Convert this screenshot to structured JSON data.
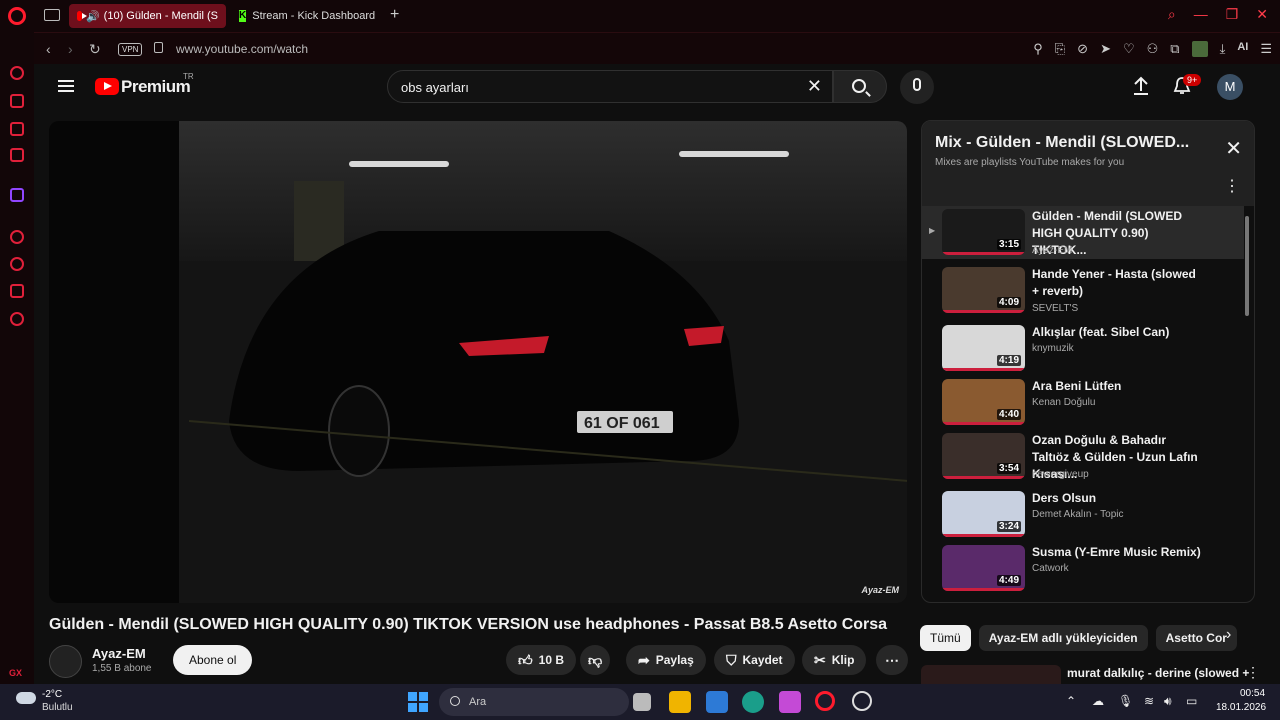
{
  "browser": {
    "tabs": [
      {
        "label": "(10) Gülden - Mendil (S"
      },
      {
        "label": "Stream - Kick Dashboard"
      }
    ],
    "url": "www.youtube.com/watch",
    "vpn_label": "VPN",
    "ai_label": "AI"
  },
  "youtube": {
    "brand": "Premium",
    "region": "TR",
    "search_query": "obs ayarları",
    "notification_count": "9+",
    "avatar_letter": "M",
    "video": {
      "title": "Gülden - Mendil (SLOWED HIGH QUALITY 0.90) TIKTOK VERSION use headphones - Passat B8.5 Asetto Corsa",
      "watermark": "Ayaz-EM",
      "channel": "Ayaz-EM",
      "subscribers": "1,55 B abone",
      "subscribe_label": "Abone ol",
      "like_count": "10 B",
      "share_label": "Paylaş",
      "save_label": "Kaydet",
      "clip_label": "Klip"
    },
    "playlist": {
      "title": "Mix - Gülden - Mendil (SLOWED...",
      "subtitle": "Mixes are playlists YouTube makes for you",
      "items": [
        {
          "title": "Gülden - Mendil (SLOWED HIGH QUALITY 0.90) TIKTOK...",
          "channel": "Ayaz-EM",
          "duration": "3:15",
          "thumb": "#1a1a1a"
        },
        {
          "title": "Hande Yener - Hasta (slowed + reverb)",
          "channel": "SEVELT'S",
          "duration": "4:09",
          "thumb": "#4a3a2e"
        },
        {
          "title": "Alkışlar (feat. Sibel Can)",
          "channel": "knymuzik",
          "duration": "4:19",
          "thumb": "#d8d8d8"
        },
        {
          "title": "Ara Beni Lütfen",
          "channel": "Kenan Doğulu",
          "duration": "4:40",
          "thumb": "#8a5a30"
        },
        {
          "title": "Ozan Doğulu & Bahadır Taltıöz & Gülden - Uzun Lafın Kısası...",
          "channel": "newergiveup",
          "duration": "3:54",
          "thumb": "#3a2e2a"
        },
        {
          "title": "Ders Olsun",
          "channel": "Demet Akalın - Topic",
          "duration": "3:24",
          "thumb": "#c8d0e0"
        },
        {
          "title": "Susma (Y-Emre Music Remix)",
          "channel": "Catwork",
          "duration": "4:49",
          "thumb": "#5a2a6a"
        }
      ]
    },
    "chips": [
      "Tümü",
      "Ayaz-EM adlı yükleyiciden",
      "Asetto Cor"
    ],
    "recommendation_title": "murat dalkılıç - derine (slowed +"
  },
  "taskbar": {
    "temperature": "-2°C",
    "weather": "Bulutlu",
    "search_label": "Ara",
    "time": "00:54",
    "date": "18.01.2026"
  },
  "colors": {
    "opera_accent": "#ff1b2d",
    "youtube_red": "#ff0000",
    "progress_red": "#cc1f3d"
  }
}
